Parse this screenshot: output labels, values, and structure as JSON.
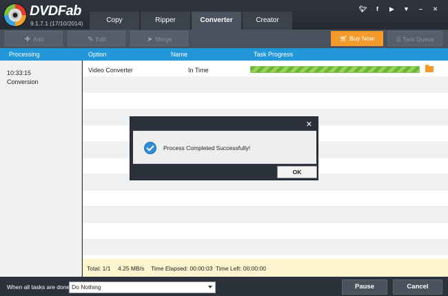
{
  "app": {
    "name": "DVDFab",
    "version": "9.1.7.1 (17/10/2014)"
  },
  "tabs": [
    {
      "label": "Copy",
      "active": false
    },
    {
      "label": "Ripper",
      "active": false
    },
    {
      "label": "Converter",
      "active": true
    },
    {
      "label": "Creator",
      "active": false
    }
  ],
  "social_icons": [
    "twitter-icon",
    "facebook-icon",
    "youtube-icon",
    "dropdown-icon",
    "minimize-icon",
    "close-icon"
  ],
  "toolbar": {
    "add_label": "Add",
    "edit_label": "Edit",
    "merge_label": "Merge",
    "buy_now_label": "Buy Now",
    "task_queue_label": "Task Queue"
  },
  "columns": {
    "processing": "Processing",
    "option": "Option",
    "name": "Name",
    "task_progress": "Task Progress"
  },
  "left_panel": {
    "time": "10:33:15",
    "status": "Conversion"
  },
  "tasks": [
    {
      "option": "Video Converter",
      "name": "In Time",
      "progress": 1.0
    }
  ],
  "status_bar": {
    "total": "Total: 1/1",
    "speed": "4.25 MB/s",
    "time_elapsed": "Time Elapsed: 00:00:03",
    "time_left": "Time Left: 00:00:00"
  },
  "footer": {
    "label": "When all tasks are done:",
    "select_value": "Do Nothing",
    "pause_label": "Pause",
    "cancel_label": "Cancel"
  },
  "dialog": {
    "message": "Process Completed Successfully!",
    "ok_label": "OK",
    "close_glyph": "✕"
  },
  "colors": {
    "accent_blue": "#2398d8",
    "buy_orange": "#f39a2b",
    "progress_green": "#68b832",
    "status_bar_bg": "#fcf4cf"
  }
}
